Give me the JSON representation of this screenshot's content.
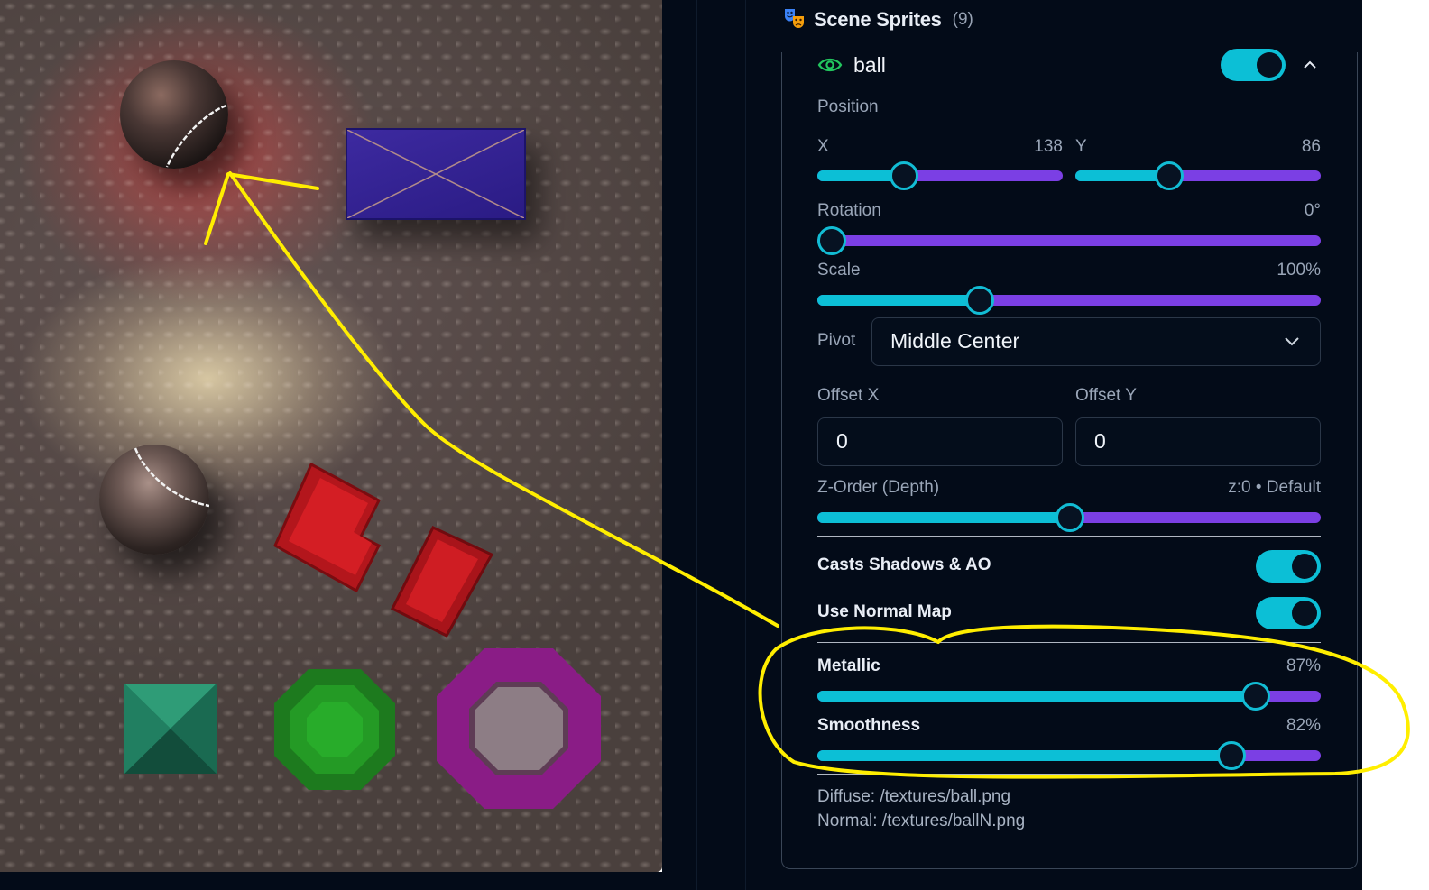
{
  "panel": {
    "title": "Scene Sprites",
    "count": "(9)"
  },
  "sprite": {
    "name": "ball",
    "visible_toggle": true,
    "position_label": "Position",
    "x_label": "X",
    "x_value": "138",
    "x_level": 0.35,
    "y_label": "Y",
    "y_value": "86",
    "y_level": 0.38,
    "rotation_label": "Rotation",
    "rotation_value": "0°",
    "rotation_level": 0.0,
    "scale_label": "Scale",
    "scale_value": "100%",
    "scale_level": 0.32,
    "pivot_label": "Pivot",
    "pivot_value": "Middle Center",
    "offset_x_label": "Offset X",
    "offset_x_value": "0",
    "offset_y_label": "Offset Y",
    "offset_y_value": "0",
    "zorder_label": "Z-Order (Depth)",
    "zorder_value": "z:0 • Default",
    "zorder_level": 0.5,
    "casts_shadows_label": "Casts Shadows & AO",
    "casts_shadows": true,
    "normal_map_label": "Use Normal Map",
    "normal_map": true,
    "metallic_label": "Metallic",
    "metallic_value": "87%",
    "metallic_level": 0.87,
    "smoothness_label": "Smoothness",
    "smoothness_value": "82%",
    "smoothness_level": 0.82,
    "diffuse": "Diffuse: /textures/ball.png",
    "normal": "Normal: /textures/ballN.png"
  },
  "colors": {
    "accent_fill": "#0cbfd6",
    "accent_track": "#7b3fe4",
    "panel_bg": "#030b18",
    "annotation": "#ffee00"
  }
}
